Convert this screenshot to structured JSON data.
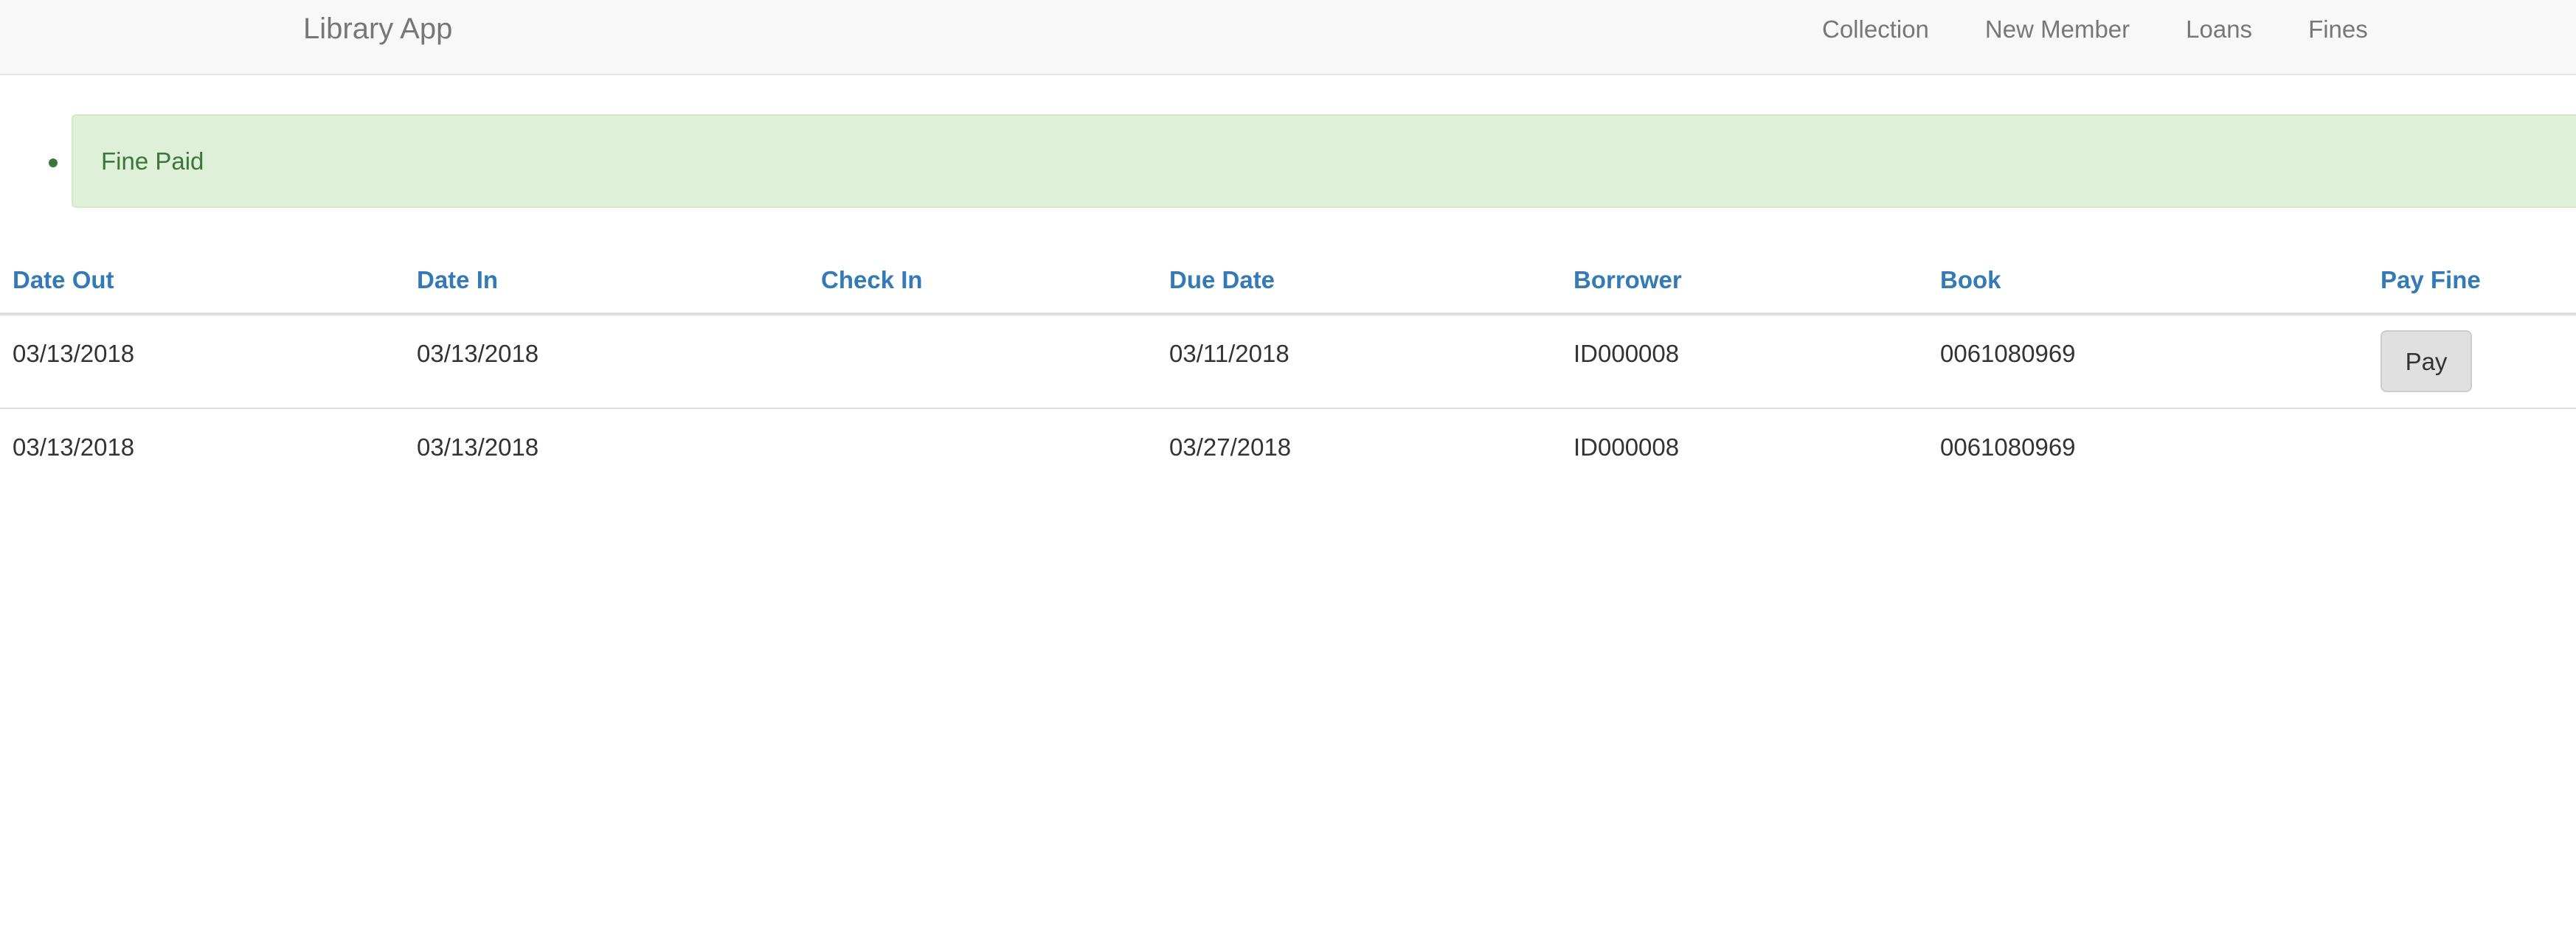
{
  "navbar": {
    "brand": "Library App",
    "links": [
      "Collection",
      "New Member",
      "Loans",
      "Fines"
    ]
  },
  "alerts": [
    {
      "text": "Fine Paid",
      "status_color": "#3c763d",
      "background": "#dff0d8"
    }
  ],
  "table": {
    "headers": [
      "Date Out",
      "Date In",
      "Check In",
      "Due Date",
      "Borrower",
      "Book",
      "Pay Fine"
    ],
    "rows": [
      {
        "date_out": "03/13/2018",
        "date_in": "03/13/2018",
        "check_in": "",
        "due_date": "03/11/2018",
        "borrower": "ID000008",
        "book": "0061080969",
        "pay_fine_label": "Pay"
      },
      {
        "date_out": "03/13/2018",
        "date_in": "03/13/2018",
        "check_in": "",
        "due_date": "03/27/2018",
        "borrower": "ID000008",
        "book": "0061080969",
        "pay_fine_label": ""
      }
    ]
  },
  "colors": {
    "link": "#337ab7",
    "navbar_bg": "#f8f8f8",
    "success_text": "#3c763d"
  }
}
